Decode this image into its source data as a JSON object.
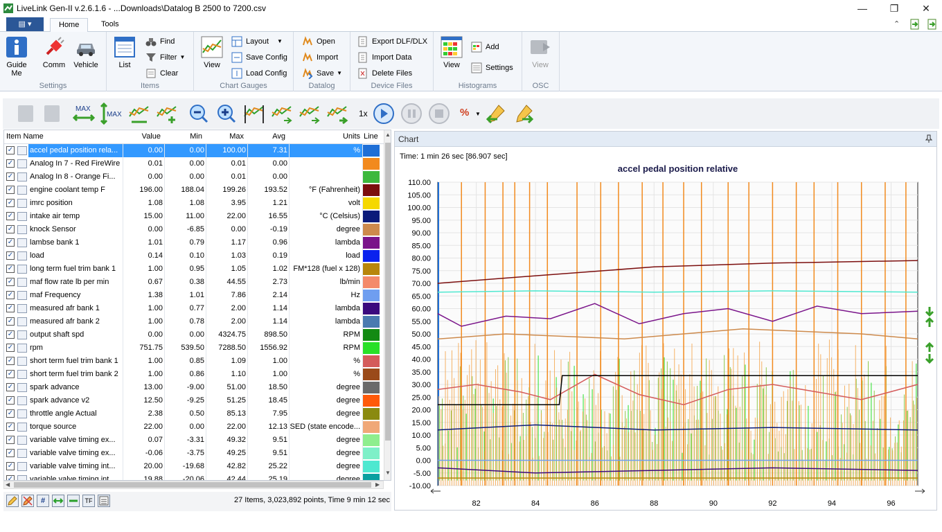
{
  "window": {
    "title": "LiveLink Gen-II  v.2.6.1.6 - ...Downloads\\Datalog B 2500 to 7200.csv",
    "minimize": "—",
    "maximize": "❐",
    "close": "✕"
  },
  "tabs": {
    "file_icon": "▤ ▾",
    "home": "Home",
    "tools": "Tools"
  },
  "ribbon": {
    "settings": {
      "label": "Settings",
      "guide": "Guide\nMe",
      "guide1": "Guide",
      "guide2": "Me",
      "comm": "Comm",
      "vehicle": "Vehicle"
    },
    "items": {
      "label": "Items",
      "list": "List",
      "find": "Find",
      "filter": "Filter",
      "clear": "Clear"
    },
    "chart_gauges": {
      "label": "Chart  Gauges",
      "view": "View",
      "layout": "Layout",
      "save_config": "Save Config",
      "load_config": "Load Config"
    },
    "datalog": {
      "label": "Datalog",
      "open": "Open",
      "import": "Import",
      "save": "Save"
    },
    "device_files": {
      "label": "Device Files",
      "export": "Export DLF/DLX",
      "import_data": "Import Data",
      "delete_files": "Delete Files"
    },
    "histograms": {
      "label": "Histograms",
      "view": "View",
      "add": "Add",
      "settings": "Settings"
    },
    "osc": {
      "label": "OSC",
      "view": "View"
    }
  },
  "toolbar": {
    "speed": "1x",
    "max1": "MAX",
    "max2": "MAX",
    "percent": "%"
  },
  "grid": {
    "headers": {
      "name": "Item Name",
      "value": "Value",
      "min": "Min",
      "max": "Max",
      "avg": "Avg",
      "units": "Units",
      "line": "Line"
    },
    "rows": [
      {
        "name": "accel pedal position rela...",
        "value": "0.00",
        "min": "0.00",
        "max": "100.00",
        "avg": "7.31",
        "units": "%",
        "color": "#1f6fd6"
      },
      {
        "name": "Analog In 7 - Red FireWire",
        "value": "0.01",
        "min": "0.00",
        "max": "0.01",
        "avg": "0.00",
        "units": "",
        "color": "#f28a1e"
      },
      {
        "name": "Analog In 8 - Orange Fi...",
        "value": "0.00",
        "min": "0.00",
        "max": "0.01",
        "avg": "0.00",
        "units": "",
        "color": "#3db83d"
      },
      {
        "name": "engine coolant temp F",
        "value": "196.00",
        "min": "188.04",
        "max": "199.26",
        "avg": "193.52",
        "units": "°F (Fahrenheit)",
        "color": "#7b0e0e"
      },
      {
        "name": "imrc position",
        "value": "1.08",
        "min": "1.08",
        "max": "3.95",
        "avg": "1.21",
        "units": "volt",
        "color": "#f5d800"
      },
      {
        "name": "intake air temp",
        "value": "15.00",
        "min": "11.00",
        "max": "22.00",
        "avg": "16.55",
        "units": "°C (Celsius)",
        "color": "#0b1b7a"
      },
      {
        "name": "knock Sensor",
        "value": "0.00",
        "min": "-6.85",
        "max": "0.00",
        "avg": "-0.19",
        "units": "degree",
        "color": "#cd8a4c"
      },
      {
        "name": "lambse bank 1",
        "value": "1.01",
        "min": "0.79",
        "max": "1.17",
        "avg": "0.96",
        "units": "lambda",
        "color": "#7a148a"
      },
      {
        "name": "load",
        "value": "0.14",
        "min": "0.10",
        "max": "1.03",
        "avg": "0.19",
        "units": "load",
        "color": "#0a22ee"
      },
      {
        "name": "long term fuel trim bank 1",
        "value": "1.00",
        "min": "0.95",
        "max": "1.05",
        "avg": "1.02",
        "units": "FM*128 (fuel x 128)",
        "color": "#b8860b"
      },
      {
        "name": "maf flow rate lb per min",
        "value": "0.67",
        "min": "0.38",
        "max": "44.55",
        "avg": "2.73",
        "units": "lb/min",
        "color": "#f48a6a"
      },
      {
        "name": "maf Frequency",
        "value": "1.38",
        "min": "1.01",
        "max": "7.86",
        "avg": "2.14",
        "units": "Hz",
        "color": "#6f9ef0"
      },
      {
        "name": "measured afr bank 1",
        "value": "1.00",
        "min": "0.77",
        "max": "2.00",
        "avg": "1.14",
        "units": "lambda",
        "color": "#3b0a7e"
      },
      {
        "name": "measured afr bank 2",
        "value": "1.00",
        "min": "0.78",
        "max": "2.00",
        "avg": "1.14",
        "units": "lambda",
        "color": "#4a7ab0"
      },
      {
        "name": "output shaft spd",
        "value": "0.00",
        "min": "0.00",
        "max": "4324.75",
        "avg": "898.50",
        "units": "RPM",
        "color": "#138a13"
      },
      {
        "name": "rpm",
        "value": "751.75",
        "min": "539.50",
        "max": "7288.50",
        "avg": "1556.92",
        "units": "RPM",
        "color": "#28e028"
      },
      {
        "name": "short term fuel trim bank 1",
        "value": "1.00",
        "min": "0.85",
        "max": "1.09",
        "avg": "1.00",
        "units": "%",
        "color": "#d45b5b"
      },
      {
        "name": "short term fuel trim bank 2",
        "value": "1.00",
        "min": "0.86",
        "max": "1.10",
        "avg": "1.00",
        "units": "%",
        "color": "#9a4a1a"
      },
      {
        "name": "spark advance",
        "value": "13.00",
        "min": "-9.00",
        "max": "51.00",
        "avg": "18.50",
        "units": "degree",
        "color": "#6a6a6a"
      },
      {
        "name": "spark advance v2",
        "value": "12.50",
        "min": "-9.25",
        "max": "51.25",
        "avg": "18.45",
        "units": "degree",
        "color": "#ff5a0a"
      },
      {
        "name": "throttle angle Actual",
        "value": "2.38",
        "min": "0.50",
        "max": "85.13",
        "avg": "7.95",
        "units": "degree",
        "color": "#8a8a10"
      },
      {
        "name": "torque source",
        "value": "22.00",
        "min": "0.00",
        "max": "22.00",
        "avg": "12.13",
        "units": "SED (state encode...",
        "color": "#f0a878"
      },
      {
        "name": "variable valve timing ex...",
        "value": "0.07",
        "min": "-3.31",
        "max": "49.32",
        "avg": "9.51",
        "units": "degree",
        "color": "#8eee8e"
      },
      {
        "name": "variable valve timing ex...",
        "value": "-0.06",
        "min": "-3.75",
        "max": "49.25",
        "avg": "9.51",
        "units": "degree",
        "color": "#7ef0c8"
      },
      {
        "name": "variable valve timing int...",
        "value": "20.00",
        "min": "-19.68",
        "max": "42.82",
        "avg": "25.22",
        "units": "degree",
        "color": "#4ee8d0"
      },
      {
        "name": "variable valve timing int...",
        "value": "19.88",
        "min": "-20.06",
        "max": "42.44",
        "avg": "25.19",
        "units": "degree",
        "color": "#0aa0a0"
      }
    ]
  },
  "status": "27 Items, 3,023,892 points, Time 9 min 12 sec",
  "chart_panel": {
    "tab": "Chart",
    "time": "Time: 1 min 26 sec [86.907 sec]",
    "pin": "📌"
  },
  "chart_data": {
    "type": "line",
    "title": "accel pedal position relative",
    "xlabel": "",
    "ylabel": "",
    "xlim": [
      80.7,
      96.9
    ],
    "ylim": [
      -10,
      110
    ],
    "yticks": [
      "110.00",
      "105.00",
      "100.00",
      "95.00",
      "90.00",
      "85.00",
      "80.00",
      "75.00",
      "70.00",
      "65.00",
      "60.00",
      "55.00",
      "50.00",
      "45.00",
      "40.00",
      "35.00",
      "30.00",
      "25.00",
      "20.00",
      "15.00",
      "10.00",
      "5.00",
      "0.00",
      "-5.00",
      "-10.00"
    ],
    "xticks": [
      "82",
      "84",
      "86",
      "88",
      "90",
      "92",
      "94",
      "96"
    ],
    "series": [
      {
        "color": "#7b0e0e",
        "x": [
          80.7,
          84,
          88,
          92,
          96.9
        ],
        "y": [
          70,
          73,
          76.5,
          78,
          79
        ]
      },
      {
        "color": "#4ee8d0",
        "x": [
          80.7,
          84,
          88,
          92,
          96.9
        ],
        "y": [
          66.5,
          67,
          66.5,
          67,
          66.5
        ]
      },
      {
        "color": "#cd8a4c",
        "x": [
          80.7,
          83,
          85,
          87,
          89,
          91,
          93,
          95,
          96.9
        ],
        "y": [
          48,
          50,
          49,
          48,
          50,
          52,
          51,
          50,
          48
        ]
      },
      {
        "color": "#7a148a",
        "x": [
          80.7,
          81.5,
          83,
          84.5,
          86,
          87.5,
          89,
          90.5,
          92,
          93.5,
          95,
          96.9
        ],
        "y": [
          58,
          53,
          57,
          56,
          62,
          54,
          58,
          60,
          55,
          61,
          58,
          59
        ]
      },
      {
        "color": "#d45b5b",
        "x": [
          80.7,
          82,
          83.5,
          84.5,
          86,
          87.5,
          89,
          90.5,
          92,
          93.5,
          95,
          96.9
        ],
        "y": [
          28,
          30,
          27,
          24,
          34,
          26,
          22,
          28,
          30,
          27,
          24,
          30
        ]
      },
      {
        "color": "#000000",
        "x": [
          80.7,
          84.8,
          84.9,
          96.9
        ],
        "y": [
          22,
          22,
          33.5,
          33.5
        ]
      },
      {
        "color": "#0b1b7a",
        "x": [
          80.7,
          84,
          88,
          92,
          96.9
        ],
        "y": [
          12,
          14,
          12,
          13,
          12
        ]
      },
      {
        "color": "#3b0a7e",
        "x": [
          80.7,
          84,
          88,
          92,
          96.9
        ],
        "y": [
          -3,
          -5,
          -4,
          -3,
          -4
        ]
      },
      {
        "color": "#b8860b",
        "x": [
          80.7,
          96.9
        ],
        "y": [
          -7,
          -7
        ]
      },
      {
        "color": "#6f9ef0",
        "x": [
          80.7,
          96.9
        ],
        "y": [
          0,
          0
        ]
      }
    ],
    "spikes": {
      "orange_x": [
        81.5,
        82.3,
        82.9,
        83.3,
        83.8,
        84.4,
        85.4,
        86.2,
        86.8,
        87.6,
        88.3,
        89.0,
        89.6,
        90.5,
        91.2,
        92.0,
        92.8,
        93.4,
        94.2,
        95.0,
        95.8,
        96.5
      ],
      "orange_top": 110,
      "orange_bottom": -10
    }
  },
  "icons": {
    "app": "livelink-icon",
    "guide": "info-icon",
    "comm": "plug-icon",
    "vehicle": "car-icon"
  }
}
